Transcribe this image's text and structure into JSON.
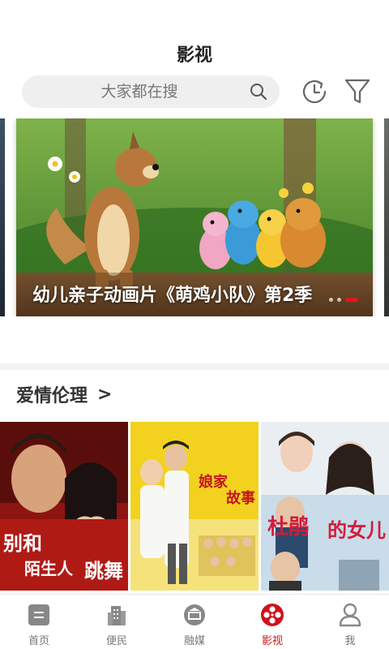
{
  "header": {
    "title": "影视"
  },
  "search": {
    "placeholder": "大家都在搜"
  },
  "banner": {
    "caption": "幼儿亲子动画片《萌鸡小队》第2季",
    "dot_count": 3,
    "active_dot": 3
  },
  "section": {
    "title": "爱情伦理",
    "arrow": ">"
  },
  "posters": [
    {
      "title": "别和陌生人跳舞"
    },
    {
      "title": "娘家的故事"
    },
    {
      "title": "杜鹃的女儿"
    }
  ],
  "tabs": [
    {
      "label": "首页",
      "icon": "home-icon"
    },
    {
      "label": "便民",
      "icon": "building-icon"
    },
    {
      "label": "融媒",
      "icon": "media-icon"
    },
    {
      "label": "影视",
      "icon": "film-reel-icon",
      "active": true
    },
    {
      "label": "我",
      "icon": "user-icon"
    }
  ],
  "colors": {
    "accent": "#d0121b",
    "search_bg": "#efefef",
    "tab_inactive": "#777777"
  }
}
